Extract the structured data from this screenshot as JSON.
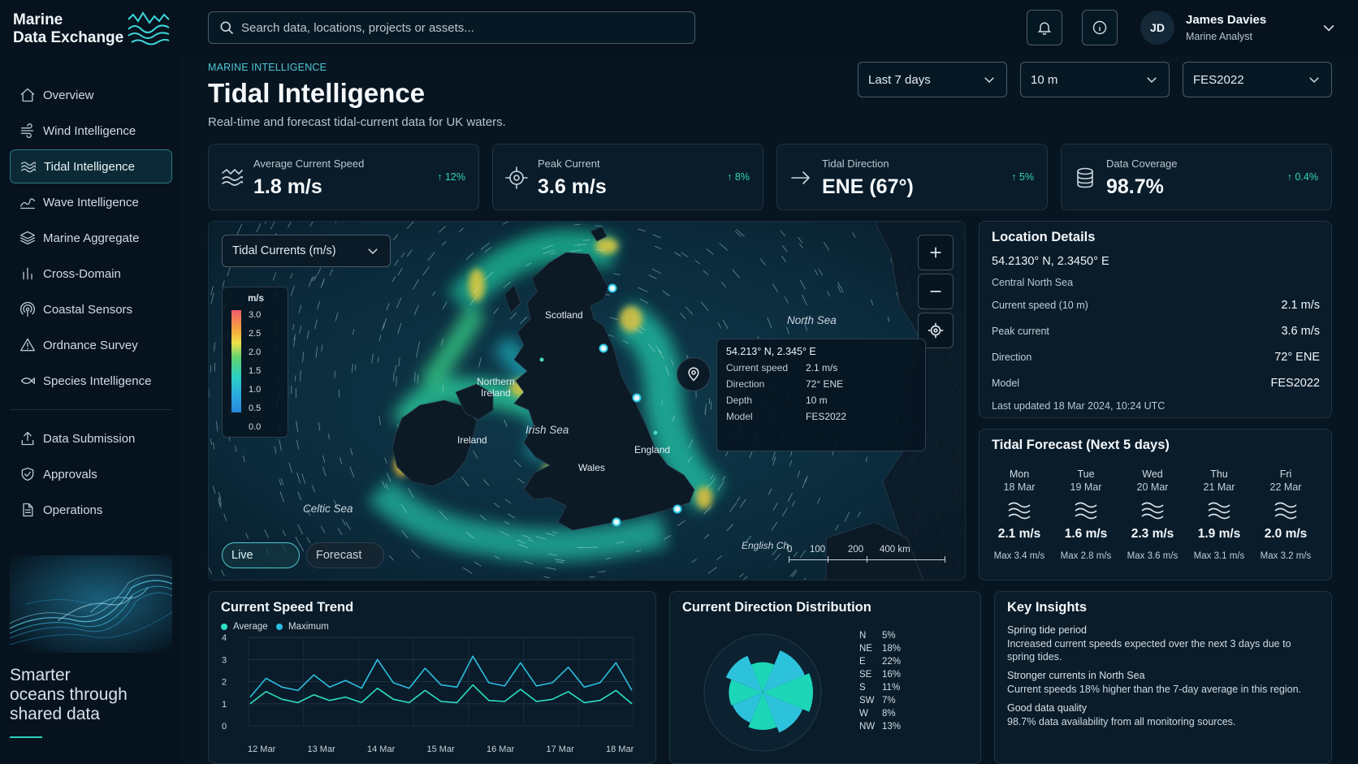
{
  "app": {
    "title_line1": "Marine",
    "title_line2": "Data Exchange"
  },
  "sidebar": {
    "items": [
      {
        "label": "Overview",
        "icon": "home-icon"
      },
      {
        "label": "Wind Intelligence",
        "icon": "wind-icon"
      },
      {
        "label": "Tidal Intelligence",
        "icon": "waves-icon",
        "active": true
      },
      {
        "label": "Wave Intelligence",
        "icon": "wave-icon"
      },
      {
        "label": "Marine Aggregate",
        "icon": "layers-icon"
      },
      {
        "label": "Cross-Domain",
        "icon": "bar-chart-icon"
      },
      {
        "label": "Coastal Sensors",
        "icon": "signal-icon"
      },
      {
        "label": "Ordnance Survey",
        "icon": "warning-icon"
      },
      {
        "label": "Species Intelligence",
        "icon": "fish-icon"
      }
    ],
    "secondary": [
      {
        "label": "Data Submission",
        "icon": "upload-icon"
      },
      {
        "label": "Approvals",
        "icon": "shield-check-icon"
      },
      {
        "label": "Operations",
        "icon": "document-icon"
      }
    ],
    "tagline_1": "Smarter",
    "tagline_2": "oceans through",
    "tagline_3": "shared data"
  },
  "header": {
    "search_placeholder": "Search data, locations, projects or assets...",
    "user_initials": "JD",
    "user_name": "James Davies",
    "user_role": "Marine Analyst"
  },
  "page": {
    "eyebrow": "MARINE INTELLIGENCE",
    "title": "Tidal Intelligence",
    "subtitle": "Real-time and forecast tidal-current data for UK waters.",
    "filters": {
      "period": "Last 7 days",
      "depth": "10 m",
      "model": "FES2022"
    }
  },
  "kpis": [
    {
      "label": "Average Current Speed",
      "value": "1.8 m/s",
      "delta": "12%",
      "icon": "waves-icon"
    },
    {
      "label": "Peak Current",
      "value": "3.6 m/s",
      "delta": "8%",
      "icon": "target-icon"
    },
    {
      "label": "Tidal Direction",
      "value": "ENE (67°)",
      "delta": "5%",
      "icon": "arrow-right-icon"
    },
    {
      "label": "Data Coverage",
      "value": "98.7%",
      "delta": "0.4%",
      "icon": "database-icon"
    }
  ],
  "map": {
    "layer": "Tidal Currents (m/s)",
    "legend_unit": "m/s",
    "legend_ticks": [
      "3.0",
      "2.5",
      "2.0",
      "1.5",
      "1.0",
      "0.5",
      "0.0"
    ],
    "labels": {
      "scotland": "Scotland",
      "ni_1": "Northern",
      "ni_2": "Ireland",
      "ireland": "Ireland",
      "england": "England",
      "wales": "Wales"
    },
    "seas": {
      "north": "North Sea",
      "irish": "Irish Sea",
      "celtic": "Celtic Sea",
      "channel": "English Ch"
    },
    "tooltip": {
      "coords": "54.213° N, 2.345° E",
      "rows": [
        {
          "k": "Current speed",
          "v": "2.1 m/s"
        },
        {
          "k": "Direction",
          "v": "72° ENE"
        },
        {
          "k": "Depth",
          "v": "10 m"
        },
        {
          "k": "Model",
          "v": "FES2022"
        }
      ]
    },
    "modes": {
      "live": "Live",
      "forecast": "Forecast"
    },
    "scale": [
      "0",
      "100",
      "200",
      "400 km"
    ]
  },
  "location": {
    "title": "Location Details",
    "coords": "54.2130° N, 2.3450° E",
    "area": "Central North Sea",
    "rows": [
      {
        "k": "Current speed (10 m)",
        "v": "2.1 m/s"
      },
      {
        "k": "Peak current",
        "v": "3.6 m/s"
      },
      {
        "k": "Direction",
        "v": "72° ENE"
      },
      {
        "k": "Model",
        "v": "FES2022"
      }
    ],
    "updated": "Last updated 18 Mar 2024, 10:24 UTC"
  },
  "forecast": {
    "title": "Tidal Forecast (Next 5 days)",
    "days": [
      {
        "day": "Mon",
        "date": "18 Mar",
        "value": "2.1 m/s",
        "max": "Max 3.4 m/s"
      },
      {
        "day": "Tue",
        "date": "19 Mar",
        "value": "1.6 m/s",
        "max": "Max 2.8 m/s"
      },
      {
        "day": "Wed",
        "date": "20 Mar",
        "value": "2.3 m/s",
        "max": "Max 3.6 m/s"
      },
      {
        "day": "Thu",
        "date": "21 Mar",
        "value": "1.9 m/s",
        "max": "Max 3.1 m/s"
      },
      {
        "day": "Fri",
        "date": "22 Mar",
        "value": "2.0 m/s",
        "max": "Max 3.2 m/s"
      }
    ]
  },
  "trend": {
    "title": "Current Speed Trend",
    "legend": [
      "Average",
      "Maximum"
    ],
    "colors": {
      "average": "#2ee0c4",
      "maximum": "#2bbfe0"
    }
  },
  "direction": {
    "title": "Current Direction Distribution",
    "items": [
      {
        "dir": "N",
        "pct": "5%"
      },
      {
        "dir": "NE",
        "pct": "18%"
      },
      {
        "dir": "E",
        "pct": "22%"
      },
      {
        "dir": "SE",
        "pct": "16%"
      },
      {
        "dir": "S",
        "pct": "11%"
      },
      {
        "dir": "SW",
        "pct": "7%"
      },
      {
        "dir": "W",
        "pct": "8%"
      },
      {
        "dir": "NW",
        "pct": "13%"
      }
    ]
  },
  "insights": {
    "title": "Key Insights",
    "items": [
      {
        "title": "Spring tide period",
        "text": "Increased current speeds expected over the next 3 days due to spring tides."
      },
      {
        "title": "Stronger currents in North Sea",
        "text": "Current speeds 18% higher than the 7-day average in this region."
      },
      {
        "title": "Good data quality",
        "text": "98.7% data availability from all monitoring sources."
      }
    ]
  },
  "chart_data": [
    {
      "type": "line",
      "title": "Current Speed Trend",
      "x": [
        "12 Mar",
        "13 Mar",
        "14 Mar",
        "15 Mar",
        "16 Mar",
        "17 Mar",
        "18 Mar"
      ],
      "ylim": [
        0,
        4
      ],
      "yticks": [
        "4",
        "3",
        "2",
        "1",
        "0"
      ],
      "series": [
        {
          "name": "Average",
          "values": [
            1.0,
            1.55,
            1.2,
            1.05,
            1.4,
            1.15,
            1.3,
            1.05,
            1.7,
            1.2,
            1.05,
            1.6,
            1.1,
            1.05,
            1.85,
            1.15,
            1.1,
            1.65,
            1.1,
            1.2,
            1.55,
            1.05,
            1.15,
            1.6,
            1.0
          ]
        },
        {
          "name": "Maximum",
          "values": [
            1.3,
            2.15,
            1.75,
            1.6,
            2.3,
            1.75,
            2.05,
            1.7,
            3.0,
            1.95,
            1.7,
            2.6,
            1.85,
            1.75,
            3.15,
            1.95,
            1.8,
            2.85,
            1.8,
            1.95,
            2.65,
            1.75,
            1.95,
            2.85,
            1.6
          ]
        }
      ]
    },
    {
      "type": "pie",
      "title": "Current Direction Distribution",
      "categories": [
        "N",
        "NE",
        "E",
        "SE",
        "S",
        "SW",
        "W",
        "NW"
      ],
      "values": [
        5,
        18,
        22,
        16,
        11,
        7,
        8,
        13
      ]
    }
  ]
}
